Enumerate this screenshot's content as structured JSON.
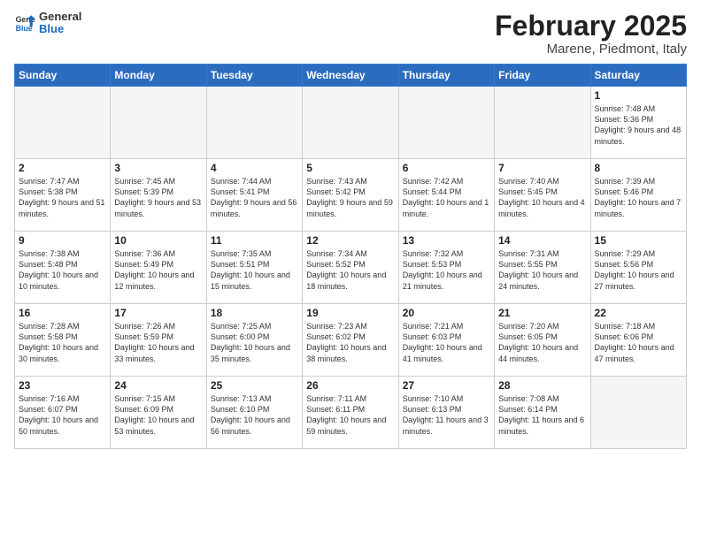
{
  "header": {
    "logo_general": "General",
    "logo_blue": "Blue",
    "month_title": "February 2025",
    "location": "Marene, Piedmont, Italy"
  },
  "weekdays": [
    "Sunday",
    "Monday",
    "Tuesday",
    "Wednesday",
    "Thursday",
    "Friday",
    "Saturday"
  ],
  "weeks": [
    [
      {
        "day": "",
        "info": ""
      },
      {
        "day": "",
        "info": ""
      },
      {
        "day": "",
        "info": ""
      },
      {
        "day": "",
        "info": ""
      },
      {
        "day": "",
        "info": ""
      },
      {
        "day": "",
        "info": ""
      },
      {
        "day": "1",
        "info": "Sunrise: 7:48 AM\nSunset: 5:36 PM\nDaylight: 9 hours and 48 minutes."
      }
    ],
    [
      {
        "day": "2",
        "info": "Sunrise: 7:47 AM\nSunset: 5:38 PM\nDaylight: 9 hours and 51 minutes."
      },
      {
        "day": "3",
        "info": "Sunrise: 7:45 AM\nSunset: 5:39 PM\nDaylight: 9 hours and 53 minutes."
      },
      {
        "day": "4",
        "info": "Sunrise: 7:44 AM\nSunset: 5:41 PM\nDaylight: 9 hours and 56 minutes."
      },
      {
        "day": "5",
        "info": "Sunrise: 7:43 AM\nSunset: 5:42 PM\nDaylight: 9 hours and 59 minutes."
      },
      {
        "day": "6",
        "info": "Sunrise: 7:42 AM\nSunset: 5:44 PM\nDaylight: 10 hours and 1 minute."
      },
      {
        "day": "7",
        "info": "Sunrise: 7:40 AM\nSunset: 5:45 PM\nDaylight: 10 hours and 4 minutes."
      },
      {
        "day": "8",
        "info": "Sunrise: 7:39 AM\nSunset: 5:46 PM\nDaylight: 10 hours and 7 minutes."
      }
    ],
    [
      {
        "day": "9",
        "info": "Sunrise: 7:38 AM\nSunset: 5:48 PM\nDaylight: 10 hours and 10 minutes."
      },
      {
        "day": "10",
        "info": "Sunrise: 7:36 AM\nSunset: 5:49 PM\nDaylight: 10 hours and 12 minutes."
      },
      {
        "day": "11",
        "info": "Sunrise: 7:35 AM\nSunset: 5:51 PM\nDaylight: 10 hours and 15 minutes."
      },
      {
        "day": "12",
        "info": "Sunrise: 7:34 AM\nSunset: 5:52 PM\nDaylight: 10 hours and 18 minutes."
      },
      {
        "day": "13",
        "info": "Sunrise: 7:32 AM\nSunset: 5:53 PM\nDaylight: 10 hours and 21 minutes."
      },
      {
        "day": "14",
        "info": "Sunrise: 7:31 AM\nSunset: 5:55 PM\nDaylight: 10 hours and 24 minutes."
      },
      {
        "day": "15",
        "info": "Sunrise: 7:29 AM\nSunset: 5:56 PM\nDaylight: 10 hours and 27 minutes."
      }
    ],
    [
      {
        "day": "16",
        "info": "Sunrise: 7:28 AM\nSunset: 5:58 PM\nDaylight: 10 hours and 30 minutes."
      },
      {
        "day": "17",
        "info": "Sunrise: 7:26 AM\nSunset: 5:59 PM\nDaylight: 10 hours and 33 minutes."
      },
      {
        "day": "18",
        "info": "Sunrise: 7:25 AM\nSunset: 6:00 PM\nDaylight: 10 hours and 35 minutes."
      },
      {
        "day": "19",
        "info": "Sunrise: 7:23 AM\nSunset: 6:02 PM\nDaylight: 10 hours and 38 minutes."
      },
      {
        "day": "20",
        "info": "Sunrise: 7:21 AM\nSunset: 6:03 PM\nDaylight: 10 hours and 41 minutes."
      },
      {
        "day": "21",
        "info": "Sunrise: 7:20 AM\nSunset: 6:05 PM\nDaylight: 10 hours and 44 minutes."
      },
      {
        "day": "22",
        "info": "Sunrise: 7:18 AM\nSunset: 6:06 PM\nDaylight: 10 hours and 47 minutes."
      }
    ],
    [
      {
        "day": "23",
        "info": "Sunrise: 7:16 AM\nSunset: 6:07 PM\nDaylight: 10 hours and 50 minutes."
      },
      {
        "day": "24",
        "info": "Sunrise: 7:15 AM\nSunset: 6:09 PM\nDaylight: 10 hours and 53 minutes."
      },
      {
        "day": "25",
        "info": "Sunrise: 7:13 AM\nSunset: 6:10 PM\nDaylight: 10 hours and 56 minutes."
      },
      {
        "day": "26",
        "info": "Sunrise: 7:11 AM\nSunset: 6:11 PM\nDaylight: 10 hours and 59 minutes."
      },
      {
        "day": "27",
        "info": "Sunrise: 7:10 AM\nSunset: 6:13 PM\nDaylight: 11 hours and 3 minutes."
      },
      {
        "day": "28",
        "info": "Sunrise: 7:08 AM\nSunset: 6:14 PM\nDaylight: 11 hours and 6 minutes."
      },
      {
        "day": "",
        "info": ""
      }
    ]
  ]
}
